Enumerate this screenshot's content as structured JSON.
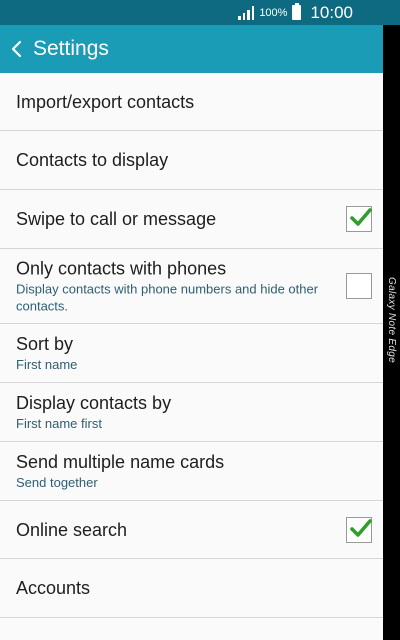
{
  "status_bar": {
    "battery_percent": "100%",
    "time": "10:00",
    "icons": [
      "signal-icon",
      "battery-icon"
    ]
  },
  "app_bar": {
    "back_icon": "chevron-left-icon",
    "title": "Settings"
  },
  "device_edge": {
    "label": "Galaxy Note Edge"
  },
  "colors": {
    "status_bar": "#0e6a80",
    "app_bar": "#1a9bb6",
    "list_background": "#fafafa",
    "subtitle_text": "#2e5f72",
    "check_green": "#2f9e2c"
  },
  "settings": [
    {
      "title": "Import/export contacts",
      "subtitle": "",
      "checkbox": null
    },
    {
      "title": "Contacts to display",
      "subtitle": "",
      "checkbox": null
    },
    {
      "title": "Swipe to call or message",
      "subtitle": "",
      "checkbox": true
    },
    {
      "title": "Only contacts with phones",
      "subtitle": "Display contacts with phone numbers and hide other contacts.",
      "checkbox": false
    },
    {
      "title": "Sort by",
      "subtitle": "First name",
      "checkbox": null
    },
    {
      "title": "Display contacts by",
      "subtitle": "First name first",
      "checkbox": null
    },
    {
      "title": "Send multiple name cards",
      "subtitle": "Send together",
      "checkbox": null
    },
    {
      "title": "Online search",
      "subtitle": "",
      "checkbox": true
    },
    {
      "title": "Accounts",
      "subtitle": "",
      "checkbox": null
    }
  ]
}
